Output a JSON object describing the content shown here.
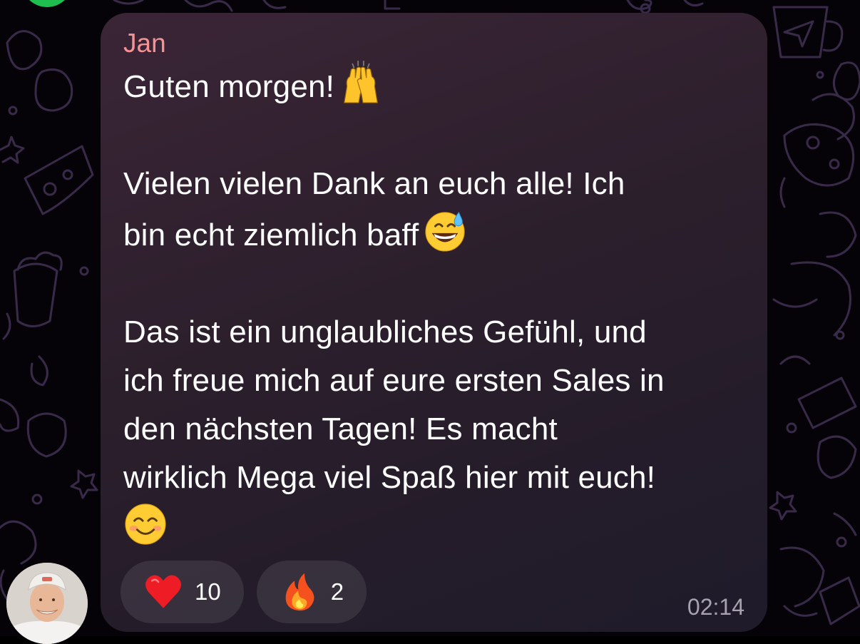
{
  "message": {
    "sender": "Jan",
    "lines": [
      "Guten morgen!",
      "",
      "Vielen vielen Dank an euch alle! Ich",
      "bin echt ziemlich baff",
      "",
      "Das ist ein unglaubliches Gefühl, und",
      "ich freue mich auf eure ersten Sales in",
      "den nächsten Tagen! Es macht",
      "wirklich Mega viel Spaß hier mit euch!"
    ],
    "emojis": [
      "raising-hands-icon",
      "grinning-sweat-icon",
      "smiling-face-icon"
    ],
    "time": "02:14"
  },
  "reactions": [
    {
      "icon": "heart-icon",
      "count": "10"
    },
    {
      "icon": "fire-icon",
      "count": "2"
    }
  ],
  "colors": {
    "sender": "#f49393",
    "bubble": "#2c1f2c",
    "background": "#050308",
    "online": "#1fbf4f"
  }
}
